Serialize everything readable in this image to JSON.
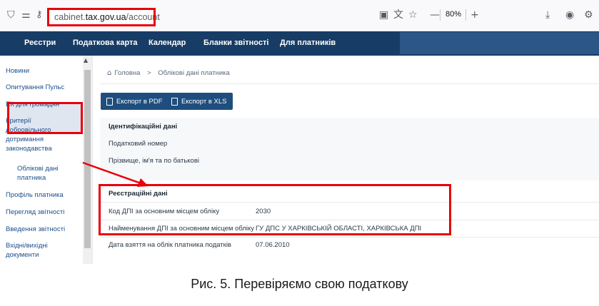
{
  "browser": {
    "url_prefix": "cabinet.",
    "url_host": "tax.gov.ua",
    "url_path": "/account",
    "zoom": "80%",
    "zoom_minus": "—",
    "zoom_plus": "+"
  },
  "nav": {
    "items": [
      "Реєстри",
      "Податкова карта",
      "Календар",
      "Бланки звітності",
      "Для платників"
    ]
  },
  "sidebar": {
    "items": [
      "Новини",
      "Опитування Пульс",
      "ЕК для громадян",
      "Критерії добровільного дотримання законодавства",
      "Облікові дані платника",
      "Профіль платника",
      "Перегляд звітності",
      "Введення звітності",
      "Вхідні/вихідні документи"
    ]
  },
  "breadcrumb": {
    "home": "Головна",
    "separator": ">",
    "current": "Облікові дані платника"
  },
  "toolbar": {
    "export_pdf": "Експорт в PDF",
    "export_xls": "Експорт в XLS"
  },
  "identification": {
    "title": "Ідентифікаційні дані",
    "tax_number_label": "Податковий номер",
    "full_name_label": "Прізвище, ім'я та по батькові"
  },
  "registration": {
    "title": "Реєстраційні дані",
    "rows": [
      {
        "label": "Код ДПІ за основним місцем обліку",
        "value": "2030"
      },
      {
        "label": "Найменування ДПІ за основним місцем обліку",
        "value": "ГУ ДПС У ХАРКІВСЬКІЙ ОБЛАСТІ, ХАРКІВСЬКА ДПІ"
      },
      {
        "label": "Дата взяття на облік платника податків",
        "value": "07.06.2010"
      }
    ]
  },
  "caption": "Рис. 5. Перевіряємо свою податкову",
  "colors": {
    "nav_bg": "#173c65",
    "button_bg": "#1f4e7e",
    "highlight": "#e8000b",
    "link": "#1b4f8a"
  }
}
